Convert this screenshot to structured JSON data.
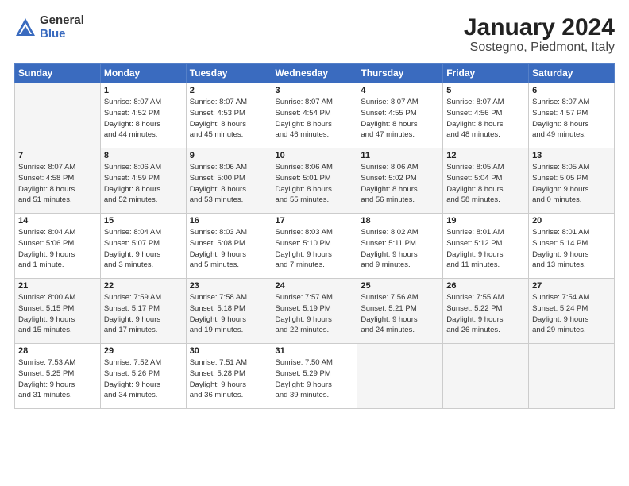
{
  "logo": {
    "general": "General",
    "blue": "Blue"
  },
  "title": {
    "month": "January 2024",
    "location": "Sostegno, Piedmont, Italy"
  },
  "weekdays": [
    "Sunday",
    "Monday",
    "Tuesday",
    "Wednesday",
    "Thursday",
    "Friday",
    "Saturday"
  ],
  "weeks": [
    [
      {
        "day": null,
        "info": null
      },
      {
        "day": "1",
        "info": "Sunrise: 8:07 AM\nSunset: 4:52 PM\nDaylight: 8 hours\nand 44 minutes."
      },
      {
        "day": "2",
        "info": "Sunrise: 8:07 AM\nSunset: 4:53 PM\nDaylight: 8 hours\nand 45 minutes."
      },
      {
        "day": "3",
        "info": "Sunrise: 8:07 AM\nSunset: 4:54 PM\nDaylight: 8 hours\nand 46 minutes."
      },
      {
        "day": "4",
        "info": "Sunrise: 8:07 AM\nSunset: 4:55 PM\nDaylight: 8 hours\nand 47 minutes."
      },
      {
        "day": "5",
        "info": "Sunrise: 8:07 AM\nSunset: 4:56 PM\nDaylight: 8 hours\nand 48 minutes."
      },
      {
        "day": "6",
        "info": "Sunrise: 8:07 AM\nSunset: 4:57 PM\nDaylight: 8 hours\nand 49 minutes."
      }
    ],
    [
      {
        "day": "7",
        "info": "Sunrise: 8:07 AM\nSunset: 4:58 PM\nDaylight: 8 hours\nand 51 minutes."
      },
      {
        "day": "8",
        "info": "Sunrise: 8:06 AM\nSunset: 4:59 PM\nDaylight: 8 hours\nand 52 minutes."
      },
      {
        "day": "9",
        "info": "Sunrise: 8:06 AM\nSunset: 5:00 PM\nDaylight: 8 hours\nand 53 minutes."
      },
      {
        "day": "10",
        "info": "Sunrise: 8:06 AM\nSunset: 5:01 PM\nDaylight: 8 hours\nand 55 minutes."
      },
      {
        "day": "11",
        "info": "Sunrise: 8:06 AM\nSunset: 5:02 PM\nDaylight: 8 hours\nand 56 minutes."
      },
      {
        "day": "12",
        "info": "Sunrise: 8:05 AM\nSunset: 5:04 PM\nDaylight: 8 hours\nand 58 minutes."
      },
      {
        "day": "13",
        "info": "Sunrise: 8:05 AM\nSunset: 5:05 PM\nDaylight: 9 hours\nand 0 minutes."
      }
    ],
    [
      {
        "day": "14",
        "info": "Sunrise: 8:04 AM\nSunset: 5:06 PM\nDaylight: 9 hours\nand 1 minute."
      },
      {
        "day": "15",
        "info": "Sunrise: 8:04 AM\nSunset: 5:07 PM\nDaylight: 9 hours\nand 3 minutes."
      },
      {
        "day": "16",
        "info": "Sunrise: 8:03 AM\nSunset: 5:08 PM\nDaylight: 9 hours\nand 5 minutes."
      },
      {
        "day": "17",
        "info": "Sunrise: 8:03 AM\nSunset: 5:10 PM\nDaylight: 9 hours\nand 7 minutes."
      },
      {
        "day": "18",
        "info": "Sunrise: 8:02 AM\nSunset: 5:11 PM\nDaylight: 9 hours\nand 9 minutes."
      },
      {
        "day": "19",
        "info": "Sunrise: 8:01 AM\nSunset: 5:12 PM\nDaylight: 9 hours\nand 11 minutes."
      },
      {
        "day": "20",
        "info": "Sunrise: 8:01 AM\nSunset: 5:14 PM\nDaylight: 9 hours\nand 13 minutes."
      }
    ],
    [
      {
        "day": "21",
        "info": "Sunrise: 8:00 AM\nSunset: 5:15 PM\nDaylight: 9 hours\nand 15 minutes."
      },
      {
        "day": "22",
        "info": "Sunrise: 7:59 AM\nSunset: 5:17 PM\nDaylight: 9 hours\nand 17 minutes."
      },
      {
        "day": "23",
        "info": "Sunrise: 7:58 AM\nSunset: 5:18 PM\nDaylight: 9 hours\nand 19 minutes."
      },
      {
        "day": "24",
        "info": "Sunrise: 7:57 AM\nSunset: 5:19 PM\nDaylight: 9 hours\nand 22 minutes."
      },
      {
        "day": "25",
        "info": "Sunrise: 7:56 AM\nSunset: 5:21 PM\nDaylight: 9 hours\nand 24 minutes."
      },
      {
        "day": "26",
        "info": "Sunrise: 7:55 AM\nSunset: 5:22 PM\nDaylight: 9 hours\nand 26 minutes."
      },
      {
        "day": "27",
        "info": "Sunrise: 7:54 AM\nSunset: 5:24 PM\nDaylight: 9 hours\nand 29 minutes."
      }
    ],
    [
      {
        "day": "28",
        "info": "Sunrise: 7:53 AM\nSunset: 5:25 PM\nDaylight: 9 hours\nand 31 minutes."
      },
      {
        "day": "29",
        "info": "Sunrise: 7:52 AM\nSunset: 5:26 PM\nDaylight: 9 hours\nand 34 minutes."
      },
      {
        "day": "30",
        "info": "Sunrise: 7:51 AM\nSunset: 5:28 PM\nDaylight: 9 hours\nand 36 minutes."
      },
      {
        "day": "31",
        "info": "Sunrise: 7:50 AM\nSunset: 5:29 PM\nDaylight: 9 hours\nand 39 minutes."
      },
      {
        "day": null,
        "info": null
      },
      {
        "day": null,
        "info": null
      },
      {
        "day": null,
        "info": null
      }
    ]
  ]
}
